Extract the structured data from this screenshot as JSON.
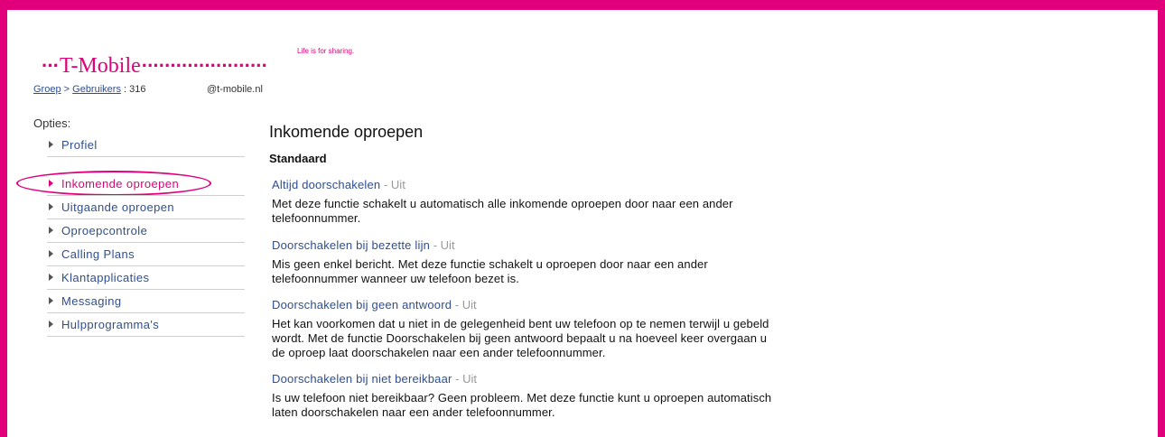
{
  "branding": {
    "logo_text": "T-Mobile",
    "logo_prefix_dots": "···",
    "logo_suffix_dots": "······················",
    "tagline": "Life is for sharing.",
    "accent_color": "#e2007a"
  },
  "breadcrumb": {
    "group": "Groep",
    "separator": ">",
    "users": "Gebruikers",
    "suffix": ": 316",
    "email": "@t-mobile.nl"
  },
  "sidebar": {
    "title": "Opties:",
    "items": [
      {
        "label": "Profiel",
        "active": false
      },
      {
        "label": "Inkomende oproepen",
        "active": true
      },
      {
        "label": "Uitgaande oproepen",
        "active": false
      },
      {
        "label": "Oproepcontrole",
        "active": false
      },
      {
        "label": "Calling Plans",
        "active": false
      },
      {
        "label": "Klantapplicaties",
        "active": false
      },
      {
        "label": "Messaging",
        "active": false
      },
      {
        "label": "Hulpprogramma's",
        "active": false
      }
    ]
  },
  "main": {
    "title": "Inkomende oproepen",
    "subtitle": "Standaard",
    "sections": [
      {
        "title": "Altijd doorschakelen",
        "status": " - Uit",
        "description": "Met deze functie schakelt u automatisch alle inkomende oproepen door naar een ander telefoonnummer."
      },
      {
        "title": "Doorschakelen bij bezette lijn",
        "status": " - Uit",
        "description": "Mis geen enkel bericht. Met deze functie schakelt u oproepen door naar een ander telefoonnummer wanneer uw telefoon bezet is."
      },
      {
        "title": "Doorschakelen bij geen antwoord",
        "status": " - Uit",
        "description": "Het kan voorkomen dat u niet in de gelegenheid bent uw telefoon op te nemen terwijl u gebeld wordt. Met de functie Doorschakelen bij geen antwoord bepaalt u na hoeveel keer overgaan u de oproep laat doorschakelen naar een ander telefoonnummer."
      },
      {
        "title": "Doorschakelen bij niet bereikbaar",
        "status": " - Uit",
        "description": "Is uw telefoon niet bereikbaar? Geen probleem. Met deze functie kunt u oproepen automatisch laten doorschakelen naar een ander telefoonnummer."
      }
    ]
  }
}
